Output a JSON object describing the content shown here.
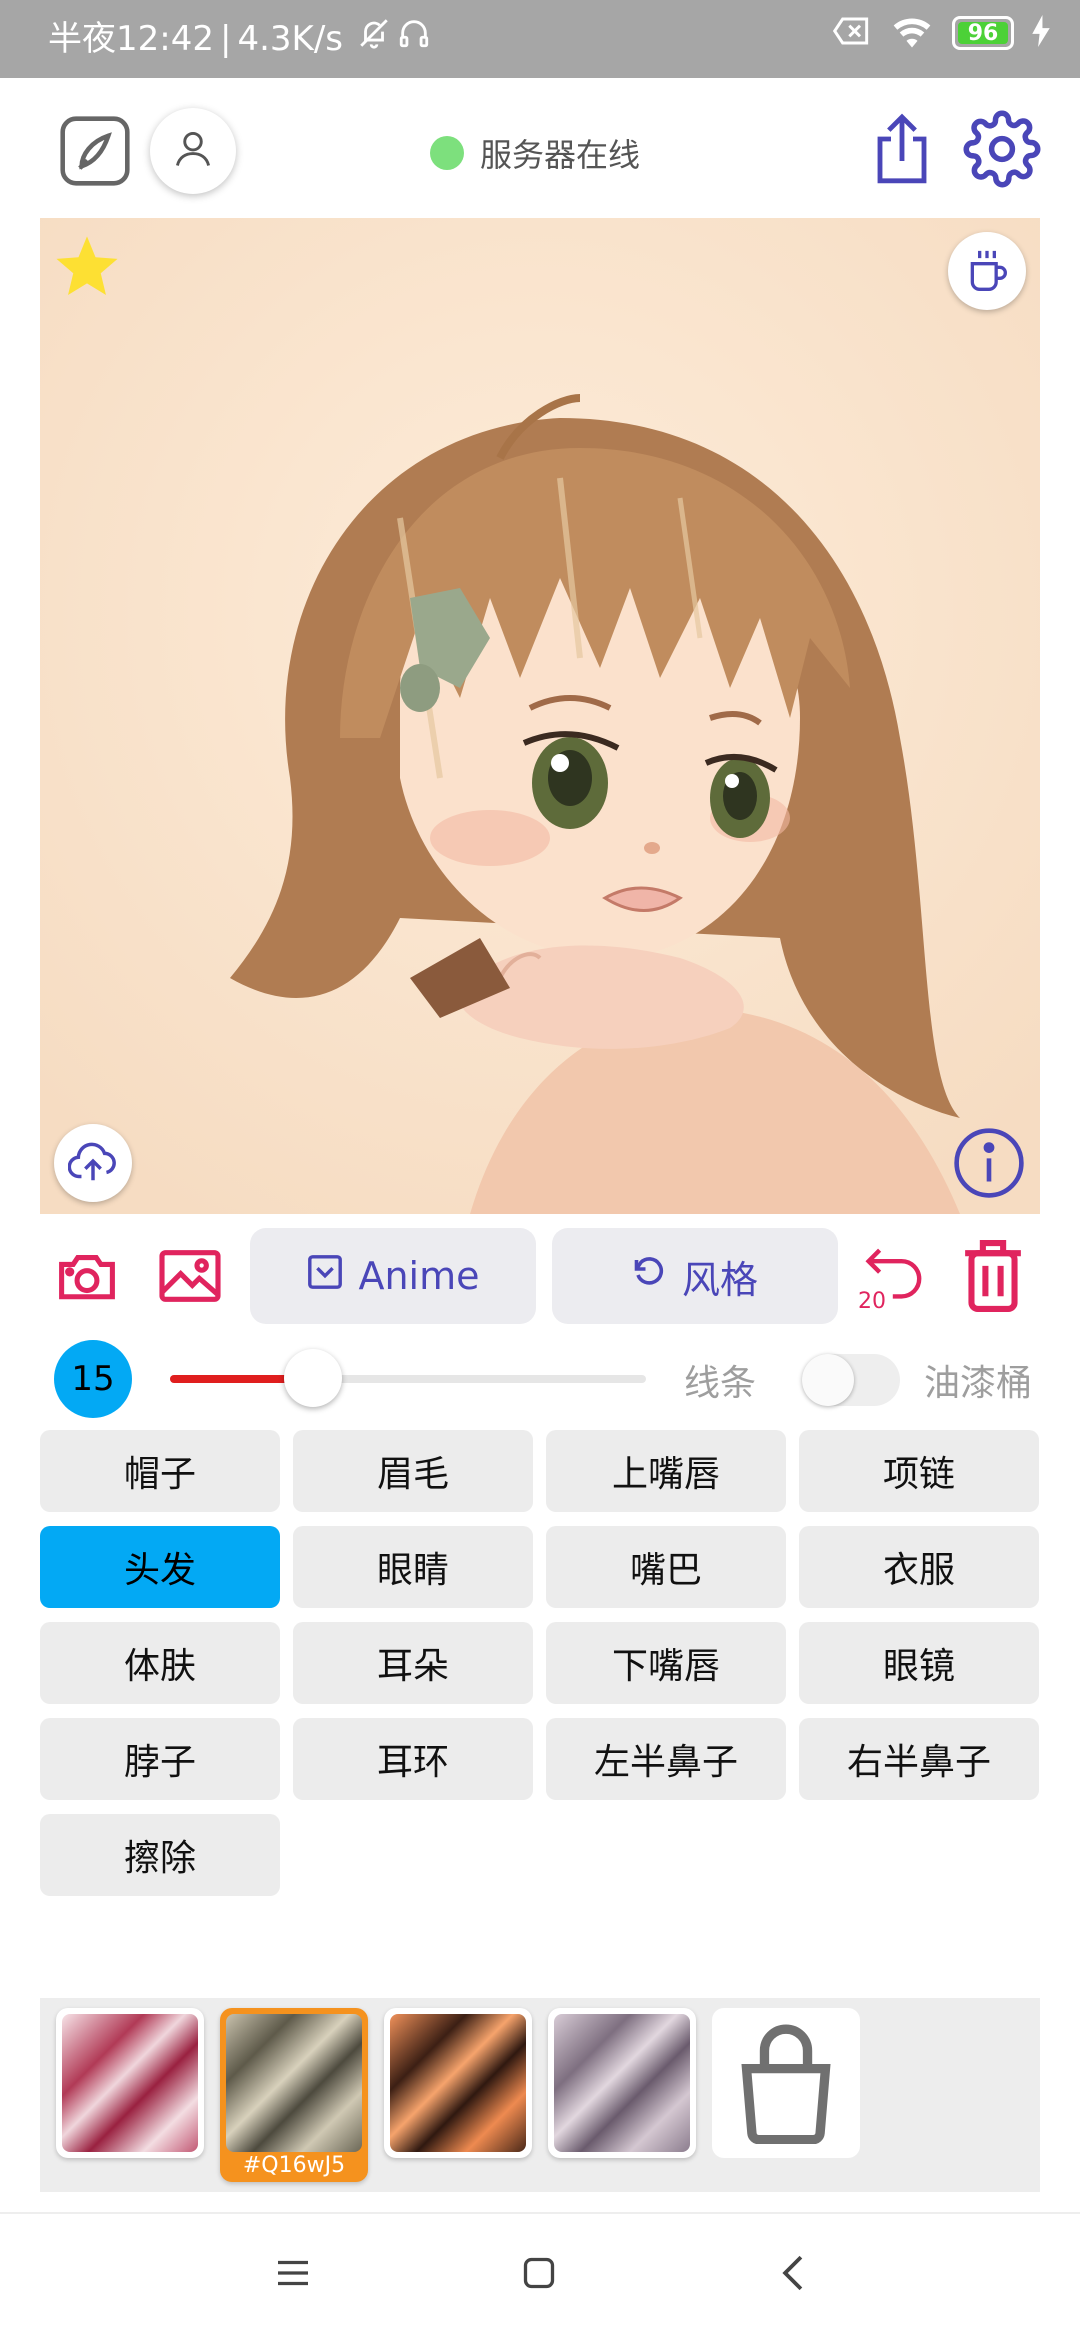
{
  "status_bar": {
    "time": "半夜12:42",
    "speed": "4.3K/s",
    "battery": "96"
  },
  "header": {
    "server_status": "服务器在线",
    "server_status_color": "#7de07d"
  },
  "icons": {
    "edit": "edit-square-icon",
    "profile": "person-icon",
    "share": "share-upload-icon",
    "settings": "gear-icon",
    "favorite": "star-icon",
    "coffee": "coffee-cup-icon",
    "cloud_upload": "cloud-upload-icon",
    "info": "info-icon",
    "camera": "camera-icon",
    "gallery": "image-icon",
    "undo": "undo-icon",
    "trash": "trash-icon",
    "shop": "shopping-bag-icon"
  },
  "toolbar": {
    "anime_label": "Anime",
    "style_label": "风格",
    "undo_count": "20"
  },
  "brush": {
    "size": "15",
    "slider_fraction": 0.3,
    "line_label": "线条",
    "bucket_label": "油漆桶",
    "bucket_enabled": false
  },
  "parts": [
    [
      "帽子",
      "眉毛",
      "上嘴唇",
      "项链"
    ],
    [
      "头发",
      "眼睛",
      "嘴巴",
      "衣服"
    ],
    [
      "体肤",
      "耳朵",
      "下嘴唇",
      "眼镜"
    ],
    [
      "脖子",
      "耳环",
      "左半鼻子",
      "右半鼻子"
    ],
    [
      "擦除"
    ]
  ],
  "selected_part": "头发",
  "textures": {
    "selected_code": "#Q16wJ5"
  },
  "colors": {
    "accent": "#4a46b8",
    "danger": "#e0245e",
    "selected": "#03a9f4",
    "texture_highlight": "#f5921e"
  }
}
